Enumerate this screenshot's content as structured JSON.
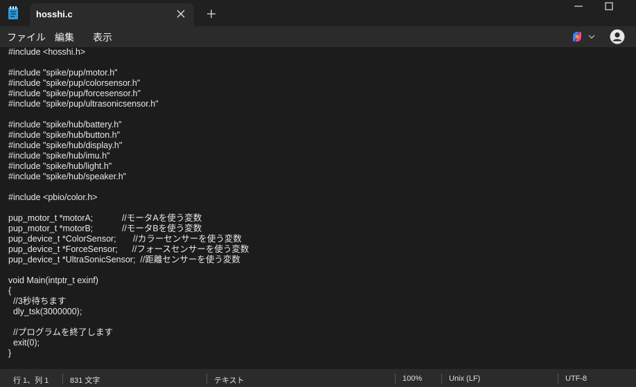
{
  "tab": {
    "title": "hosshi.c"
  },
  "menu": {
    "file": "ファイル",
    "edit": "編集",
    "view": "表示"
  },
  "editor": {
    "lines": [
      "#include <hosshi.h>",
      "",
      "#include \"spike/pup/motor.h\"",
      "#include \"spike/pup/colorsensor.h\"",
      "#include \"spike/pup/forcesensor.h\"",
      "#include \"spike/pup/ultrasonicsensor.h\"",
      "",
      "#include \"spike/hub/battery.h\"",
      "#include \"spike/hub/button.h\"",
      "#include \"spike/hub/display.h\"",
      "#include \"spike/hub/imu.h\"",
      "#include \"spike/hub/light.h\"",
      "#include \"spike/hub/speaker.h\"",
      "",
      "#include <pbio/color.h>",
      "",
      "pup_motor_t *motorA;            //モータAを使う変数",
      "pup_motor_t *motorB;            //モータBを使う変数",
      "pup_device_t *ColorSensor;       //カラーセンサーを使う変数",
      "pup_device_t *ForceSensor;      //フォースセンサーを使う変数",
      "pup_device_t *UltraSonicSensor;  //距離センサーを使う変数",
      "",
      "void Main(intptr_t exinf)",
      "{",
      "  //3秒待ちます",
      "  dly_tsk(3000000);",
      "",
      "  //プログラムを終了します",
      "  exit(0);",
      "}"
    ]
  },
  "status": {
    "position": "行 1、列 1",
    "chars": "831 文字",
    "format": "テキスト",
    "zoom": "100%",
    "eol": "Unix (LF)",
    "encoding": "UTF-8"
  }
}
